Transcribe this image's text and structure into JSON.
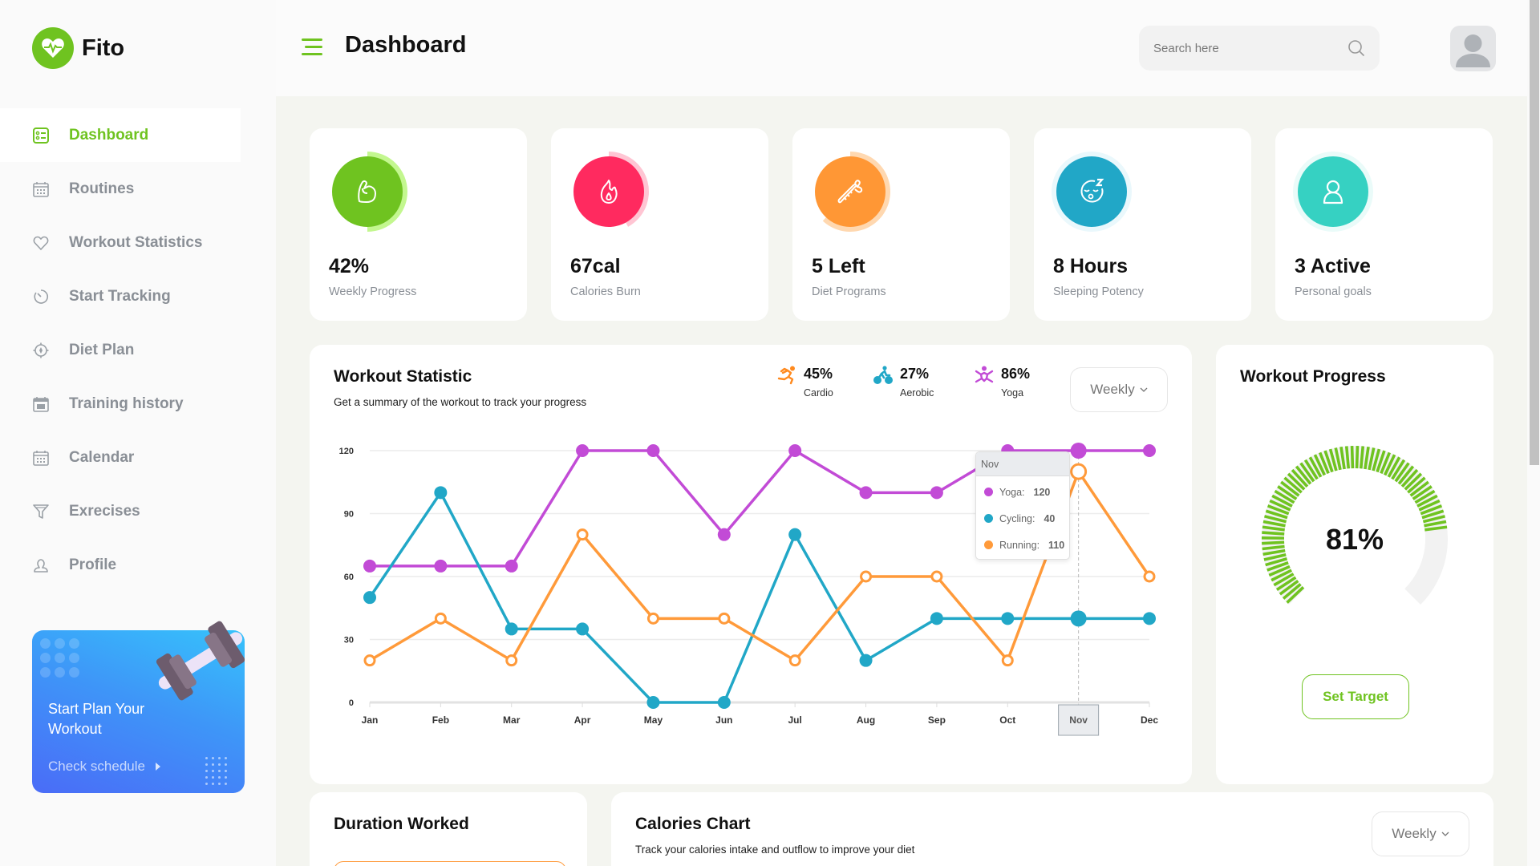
{
  "app": {
    "name": "Fito",
    "brand_color": "#6fc320"
  },
  "header": {
    "title": "Dashboard",
    "search": {
      "placeholder": "Search here",
      "value": ""
    }
  },
  "sidebar": {
    "items": [
      {
        "label": "Dashboard",
        "icon": "dashboard-icon",
        "active": true
      },
      {
        "label": "Routines",
        "icon": "calendar-icon",
        "active": false
      },
      {
        "label": "Workout Statistics",
        "icon": "heart-icon",
        "active": false
      },
      {
        "label": "Start Tracking",
        "icon": "timer-icon",
        "active": false
      },
      {
        "label": "Diet Plan",
        "icon": "target-icon",
        "active": false
      },
      {
        "label": "Training history",
        "icon": "calendar-grid-icon",
        "active": false
      },
      {
        "label": "Calendar",
        "icon": "calendar-icon",
        "active": false
      },
      {
        "label": "Exrecises",
        "icon": "filter-icon",
        "active": false
      },
      {
        "label": "Profile",
        "icon": "user-icon",
        "active": false
      }
    ],
    "promo": {
      "title": "Start Plan Your Workout",
      "link": "Check schedule"
    }
  },
  "stats": [
    {
      "value": "42%",
      "label": "Weekly Progress",
      "icon": "muscle-icon",
      "color": "#6fc320",
      "ring_color": "#c3f78f",
      "progress": 0.5
    },
    {
      "value": "67cal",
      "label": "Calories Burn",
      "icon": "flame-icon",
      "color": "#ff2a5f",
      "ring_color": "#ffc5d3",
      "progress": 0.42
    },
    {
      "value": "5 Left",
      "label": "Diet Programs",
      "icon": "carrot-icon",
      "color": "#ff9735",
      "ring_color": "#ffd8b0",
      "progress": 0.62
    },
    {
      "value": "8 Hours",
      "label": "Sleeping Potency",
      "icon": "sleep-icon",
      "color": "#21a7c7",
      "ring_color": "#eaf8fc",
      "progress": 1.0
    },
    {
      "value": "3 Active",
      "label": "Personal goals",
      "icon": "user-icon",
      "color": "#36d1c2",
      "ring_color": "#eafbf9",
      "progress": 1.0
    }
  ],
  "workout_statistic": {
    "title": "Workout Statistic",
    "subtitle": "Get a summary of the workout to track your progress",
    "legend": [
      {
        "value": "45%",
        "label": "Cardio",
        "icon": "running-icon",
        "color": "#ff8a1f"
      },
      {
        "value": "27%",
        "label": "Aerobic",
        "icon": "cycling-icon",
        "color": "#21a7c7"
      },
      {
        "value": "86%",
        "label": "Yoga",
        "icon": "yoga-icon",
        "color": "#c24bd6"
      }
    ],
    "period": "Weekly",
    "tooltip": {
      "title": "Nov",
      "rows": [
        {
          "label": "Yoga:",
          "value": "120",
          "color": "#c24bd6"
        },
        {
          "label": "Cycling:",
          "value": "40",
          "color": "#21a7c7"
        },
        {
          "label": "Running:",
          "value": "110",
          "color": "#ff9a3a"
        }
      ]
    }
  },
  "chart_data": {
    "type": "line",
    "title": "Workout Statistic",
    "xlabel": "",
    "ylabel": "",
    "categories": [
      "Jan",
      "Feb",
      "Mar",
      "Apr",
      "May",
      "Jun",
      "Jul",
      "Aug",
      "Sep",
      "Oct",
      "Nov",
      "Dec"
    ],
    "ylim": [
      0,
      120
    ],
    "yticks": [
      0,
      30,
      60,
      90,
      120
    ],
    "grid": true,
    "highlighted_category": "Nov",
    "series": [
      {
        "name": "Yoga",
        "color": "#c24bd6",
        "marker": "filled",
        "values": [
          65,
          65,
          65,
          120,
          120,
          80,
          120,
          100,
          100,
          120,
          120,
          120
        ]
      },
      {
        "name": "Cycling",
        "color": "#21a7c7",
        "marker": "filled",
        "values": [
          50,
          100,
          35,
          35,
          0,
          0,
          80,
          20,
          40,
          40,
          40,
          40
        ]
      },
      {
        "name": "Running",
        "color": "#ff9a3a",
        "marker": "hollow",
        "values": [
          20,
          40,
          20,
          80,
          40,
          40,
          20,
          60,
          60,
          20,
          110,
          60
        ]
      }
    ]
  },
  "workout_progress": {
    "title": "Workout Progress",
    "value_label": "81%",
    "progress": 0.81,
    "button": "Set Target"
  },
  "duration_worked": {
    "title": "Duration Worked"
  },
  "calories_chart": {
    "title": "Calories Chart",
    "subtitle": "Track your calories intake and outflow to improve your diet",
    "period": "Weekly"
  }
}
